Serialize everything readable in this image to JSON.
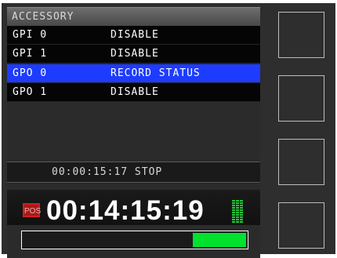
{
  "accessory": {
    "title": "ACCESSORY",
    "rows": [
      {
        "name": "GPI 0",
        "value": "DISABLE",
        "selected": false
      },
      {
        "name": "GPI 1",
        "value": "DISABLE",
        "selected": false
      },
      {
        "name": "GPO 0",
        "value": "RECORD STATUS",
        "selected": true
      },
      {
        "name": "GPO 1",
        "value": "DISABLE",
        "selected": false
      }
    ]
  },
  "status": {
    "timecode_line": "00:00:15:17 STOP"
  },
  "transport": {
    "pos_badge": "POS",
    "main_timecode": "00:14:15:19",
    "progress_fraction": 0.24
  },
  "colors": {
    "selected_row": "#1e3cff",
    "progress_fill": "#00e22d",
    "meter_green": "#27c23a",
    "pos_badge_red": "#d11f1f"
  },
  "icons": {
    "level_meter": "level-meter-icon",
    "pos_badge": "position-badge-icon"
  },
  "soft_keys": [
    {
      "label": ""
    },
    {
      "label": ""
    },
    {
      "label": ""
    },
    {
      "label": ""
    }
  ]
}
